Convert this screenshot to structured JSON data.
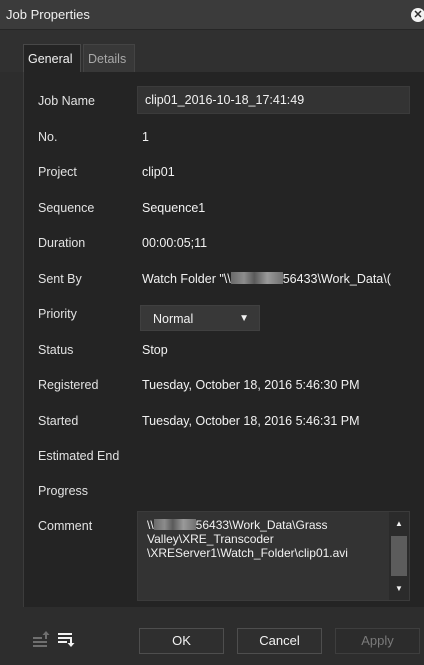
{
  "window": {
    "title": "Job Properties"
  },
  "tabs": [
    {
      "label": "General",
      "active": true
    },
    {
      "label": "Details",
      "active": false
    }
  ],
  "fields": {
    "job_name": {
      "label": "Job Name",
      "value": "clip01_2016-10-18_17:41:49"
    },
    "number": {
      "label": "No.",
      "value": "1"
    },
    "project": {
      "label": "Project",
      "value": "clip01"
    },
    "sequence": {
      "label": "Sequence",
      "value": "Sequence1"
    },
    "duration": {
      "label": "Duration",
      "value": "00:00:05;11"
    },
    "sent_by": {
      "label": "Sent By",
      "value_prefix": "Watch Folder \"\\\\",
      "value_suffix": "56433\\Work_Data\\("
    },
    "priority": {
      "label": "Priority",
      "value": "Normal",
      "options": [
        "Normal"
      ]
    },
    "status": {
      "label": "Status",
      "value": "Stop"
    },
    "registered": {
      "label": "Registered",
      "value": "Tuesday, October 18, 2016 5:46:30 PM"
    },
    "started": {
      "label": "Started",
      "value": "Tuesday, October 18, 2016 5:46:31 PM"
    },
    "estimated_end": {
      "label": "Estimated End",
      "value": ""
    },
    "progress": {
      "label": "Progress",
      "value": ""
    },
    "comment": {
      "label": "Comment",
      "value_prefix": "\\\\",
      "value_suffix": "56433\\Work_Data\\Grass Valley\\XRE_Transcoder \\XREServer1\\Watch_Folder\\clip01.avi"
    }
  },
  "footer": {
    "ok_label": "OK",
    "cancel_label": "Cancel",
    "apply_label": "Apply",
    "icons": [
      "list-move-up-icon",
      "list-move-down-icon"
    ]
  },
  "colors": {
    "background": "#2d2d2d",
    "panel": "#242424",
    "input": "#333333",
    "text": "#f2f2f2",
    "disabled_text": "#7a7a7a"
  }
}
